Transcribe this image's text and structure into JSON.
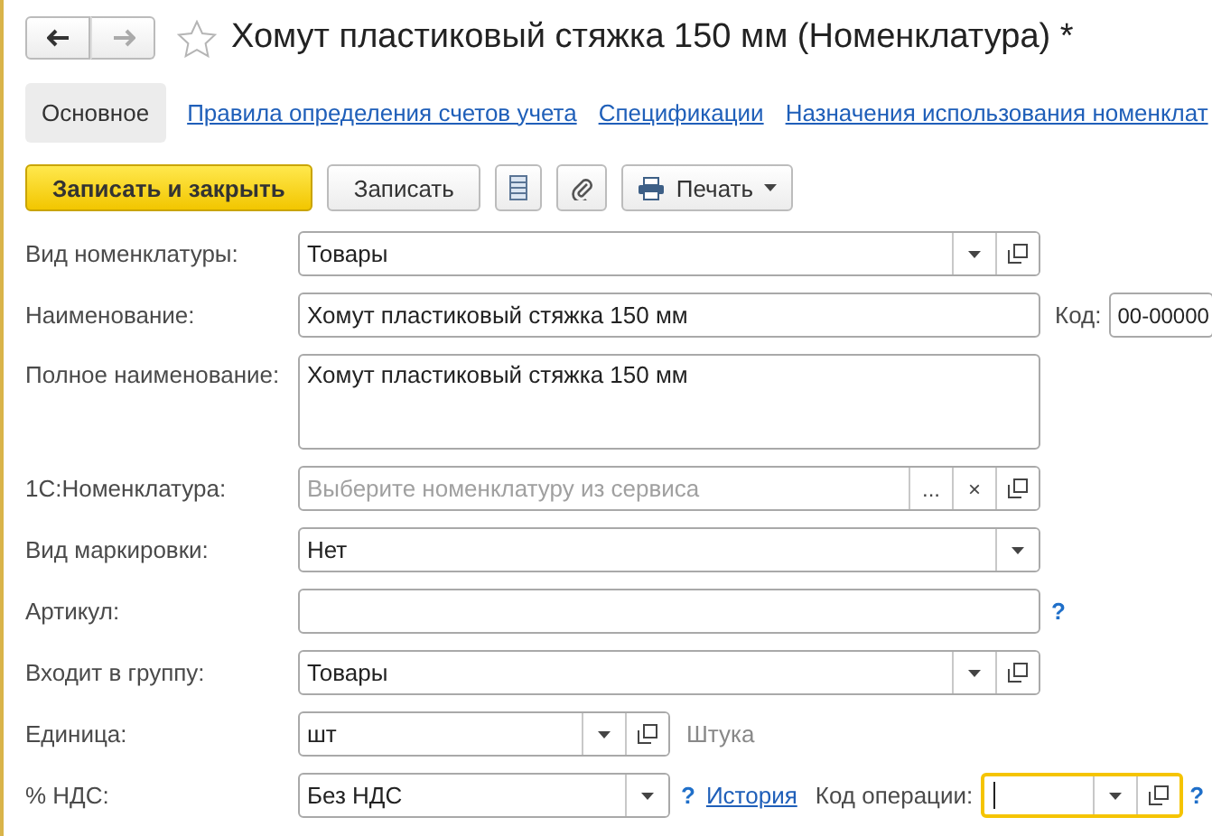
{
  "window": {
    "title": "Хомут пластиковый стяжка 150 мм (Номенклатура) *",
    "favorite": false,
    "nav": [
      {
        "kind": "back",
        "disabled": false
      },
      {
        "kind": "forward",
        "disabled": true
      }
    ]
  },
  "tabs": [
    {
      "label": "Основное",
      "selected": true
    },
    {
      "label": "Правила определения счетов учета",
      "selected": false
    },
    {
      "label": "Спецификации",
      "selected": false
    },
    {
      "label": "Назначения использования номенклат",
      "selected": false
    }
  ],
  "toolbar": [
    {
      "kind": "primary",
      "label": "Записать и закрыть"
    },
    {
      "kind": "default",
      "label": "Записать"
    },
    {
      "kind": "list"
    },
    {
      "kind": "attach"
    },
    {
      "kind": "print",
      "label": "Печать"
    }
  ],
  "fields": [
    {
      "label": "Вид номенклатуры:",
      "kind": "input",
      "value": "Товары",
      "buttons": [
        {
          "kind": "dropdown"
        },
        {
          "kind": "open"
        }
      ]
    },
    {
      "label": "Наименование:",
      "kind": "input",
      "value": "Хомут пластиковый стяжка 150 мм",
      "extras": [
        {
          "kind": "label",
          "text": "Код:"
        },
        {
          "kind": "field",
          "value": "00-00000"
        }
      ]
    },
    {
      "label": "Полное наименование:",
      "kind": "textarea",
      "value": "Хомут пластиковый стяжка 150 мм"
    },
    {
      "label": "1С:Номенклатура:",
      "kind": "input",
      "placeholder": "Выберите номенклатуру из сервиса",
      "buttons": [
        {
          "kind": "choose",
          "text": "..."
        },
        {
          "kind": "clear",
          "text": "×"
        },
        {
          "kind": "open"
        }
      ]
    },
    {
      "label": "Вид маркировки:",
      "kind": "input",
      "value": "Нет",
      "buttons": [
        {
          "kind": "dropdown"
        }
      ]
    },
    {
      "label": "Артикул:",
      "kind": "input",
      "extras": [
        {
          "kind": "help",
          "text": "?"
        }
      ]
    },
    {
      "label": "Входит в группу:",
      "kind": "input",
      "value": "Товары",
      "buttons": [
        {
          "kind": "dropdown"
        },
        {
          "kind": "open"
        }
      ]
    },
    {
      "label": "Единица:",
      "kind": "short-input",
      "value": "шт",
      "buttons": [
        {
          "kind": "dropdown"
        },
        {
          "kind": "open"
        }
      ],
      "extras": [
        {
          "kind": "hint",
          "text": "Штука"
        }
      ]
    },
    {
      "label": "% НДС:",
      "kind": "short-input",
      "value": "Без НДС",
      "buttons": [
        {
          "kind": "dropdown"
        }
      ],
      "extras": [
        {
          "kind": "help",
          "text": "?"
        },
        {
          "kind": "link",
          "text": "История"
        },
        {
          "kind": "label",
          "text": "Код операции:"
        },
        {
          "kind": "field",
          "focused": true,
          "buttons": [
            {
              "kind": "dropdown"
            },
            {
              "kind": "open"
            }
          ]
        },
        {
          "kind": "help",
          "text": "?"
        }
      ]
    }
  ]
}
